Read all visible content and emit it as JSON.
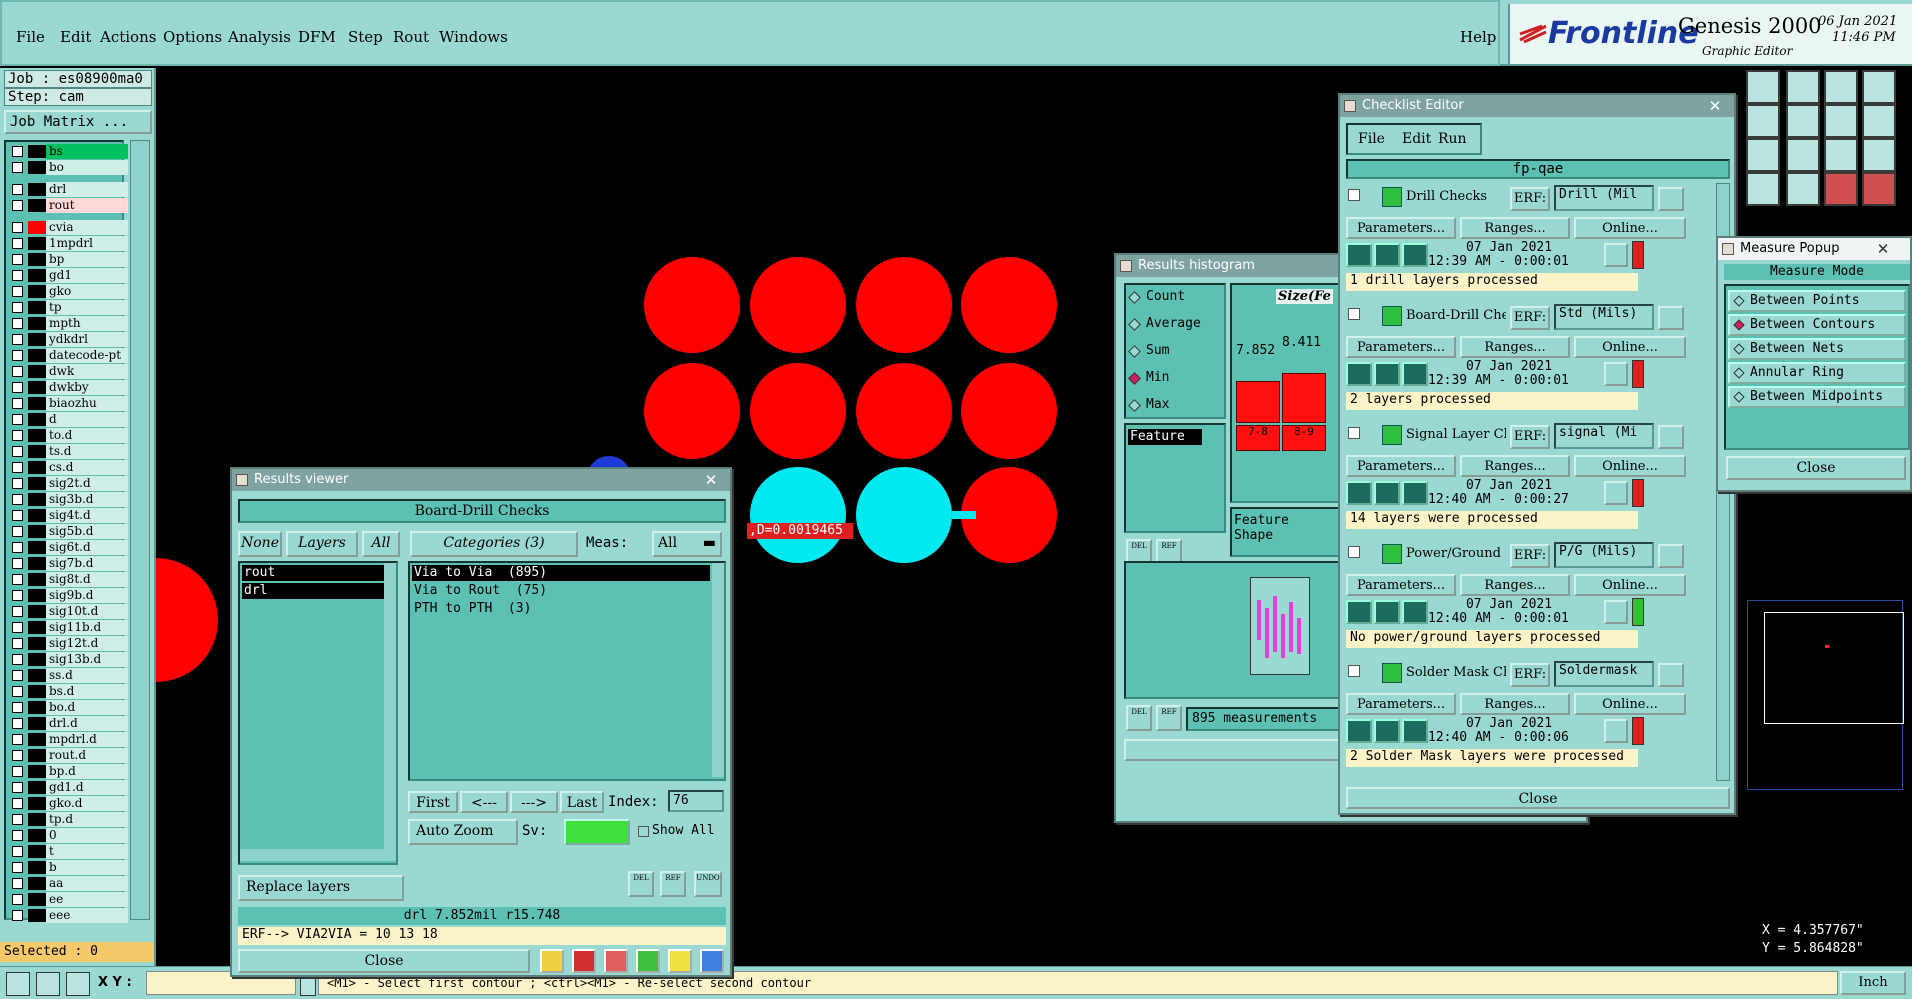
{
  "menubar": {
    "items": [
      "File",
      "Edit",
      "Actions",
      "Options",
      "Analysis",
      "DFM",
      "Step",
      "Rout",
      "Windows"
    ],
    "help": "Help",
    "brand": "Frontline",
    "product": "Genesis 2000",
    "subtitle": "Graphic Editor",
    "date": "06 Jan 2021",
    "time": "11:46 PM"
  },
  "left_panel": {
    "job": "Job : es08900ma0",
    "step": "Step: cam",
    "matrix_button": "Job Matrix ...",
    "layers": [
      "bs",
      "bo",
      "drl",
      "rout",
      "cvia",
      "1mpdrl",
      "bp",
      "gd1",
      "gko",
      "tp",
      "mpth",
      "ydkdrl",
      "datecode-pt",
      "dwk",
      "dwkby",
      "biaozhu",
      "d",
      "to.d",
      "ts.d",
      "cs.d",
      "sig2t.d",
      "sig3b.d",
      "sig4t.d",
      "sig5b.d",
      "sig6t.d",
      "sig7b.d",
      "sig8t.d",
      "sig9b.d",
      "sig10t.d",
      "sig11b.d",
      "sig12t.d",
      "sig13b.d",
      "ss.d",
      "bs.d",
      "bo.d",
      "drl.d",
      "mpdrl.d",
      "rout.d",
      "bp.d",
      "gd1.d",
      "gko.d",
      "tp.d",
      "0",
      "t",
      "b",
      "aa",
      "ee",
      "eee"
    ],
    "selected": "Selected : 0"
  },
  "canvas": {
    "measure_label": ",D=0.0019465"
  },
  "status_bar": {
    "xy_label": "X Y :",
    "prompt": "<M1> - Select first contour ; <ctrl><M1> - Re-select second contour",
    "units": "Inch"
  },
  "coords": {
    "x": "X = 4.357767\"",
    "y": "Y = 5.864828\""
  },
  "results_viewer": {
    "title": "Results viewer",
    "header": "Board-Drill Checks",
    "none_btn": "None",
    "layers_btn": "Layers",
    "all_btn": "All",
    "categories_btn": "Categories (3)",
    "meas_label": "Meas:",
    "meas_value": "All",
    "layers": [
      "rout",
      "drl"
    ],
    "categories": [
      "Via to Via  (895)",
      "Via to Rout  (75)",
      "PTH to PTH  (3)"
    ],
    "first": "First",
    "prev": "<---",
    "next": "--->",
    "last": "Last",
    "index_label": "Index:",
    "index_value": "76",
    "auto_zoom": "Auto Zoom",
    "sv_label": "Sv:",
    "show_all": "Show All",
    "replace_layers": "Replace layers",
    "info_line": "drl 7.852mil  r15.748",
    "erf_line": "ERF--> VIA2VIA = 10 13 18",
    "close": "Close",
    "del": "DEL",
    "ref": "REF",
    "undo": "UNDO"
  },
  "histogram": {
    "title": "Results histogram",
    "options": [
      "Count",
      "Average",
      "Sum",
      "Min",
      "Max"
    ],
    "selected_option": "Min",
    "size_label": "Size(Fe",
    "bar_values": [
      "7.852",
      "8.411"
    ],
    "bar_ranges": [
      "7-8",
      "8-9"
    ],
    "bar_heights": [
      0.62,
      0.7
    ],
    "feature_label": "Feature",
    "feature_shape": "Feature Shape",
    "measurements": "895 measurements",
    "del": "DEL",
    "ref": "REF"
  },
  "checklist": {
    "title": "Checklist Editor",
    "menu": [
      "File",
      "Edit",
      "Run"
    ],
    "name": "fp-qae",
    "params_btn": "Parameters...",
    "ranges_btn": "Ranges...",
    "online_btn": "Online...",
    "erf_label": "ERF:",
    "rows": [
      {
        "name": "Drill Checks",
        "erf": "Drill (Mil",
        "date": "07 Jan 2021",
        "time": "12:39 AM - 0:00:01",
        "status": "1 drill layers processed",
        "flag": "#e02020"
      },
      {
        "name": "Board-Drill Che",
        "erf": "Std (Mils)",
        "date": "07 Jan 2021",
        "time": "12:39 AM - 0:00:01",
        "status": "2 layers processed",
        "flag": "#e02020"
      },
      {
        "name": "Signal Layer Ch",
        "erf": "signal (Mi",
        "date": "07 Jan 2021",
        "time": "12:40 AM - 0:00:27",
        "status": "14 layers were processed",
        "flag": "#e02020"
      },
      {
        "name": "Power/Ground C",
        "erf": "P/G (Mils)",
        "date": "07 Jan 2021",
        "time": "12:40 AM - 0:00:01",
        "status": "No power/ground layers processed",
        "flag": "#30c030"
      },
      {
        "name": "Solder Mask Ch",
        "erf": "Soldermask",
        "date": "07 Jan 2021",
        "time": "12:40 AM - 0:00:06",
        "status": "2 Solder Mask layers were processed",
        "flag": "#e02020"
      }
    ],
    "close": "Close"
  },
  "measure_popup": {
    "title": "Measure Popup",
    "mode_label": "Measure Mode",
    "options": [
      "Between Points",
      "Between Contours",
      "Between Nets",
      "Annular Ring",
      "Between Midpoints"
    ],
    "selected_option": "Between Contours",
    "close": "Close"
  }
}
